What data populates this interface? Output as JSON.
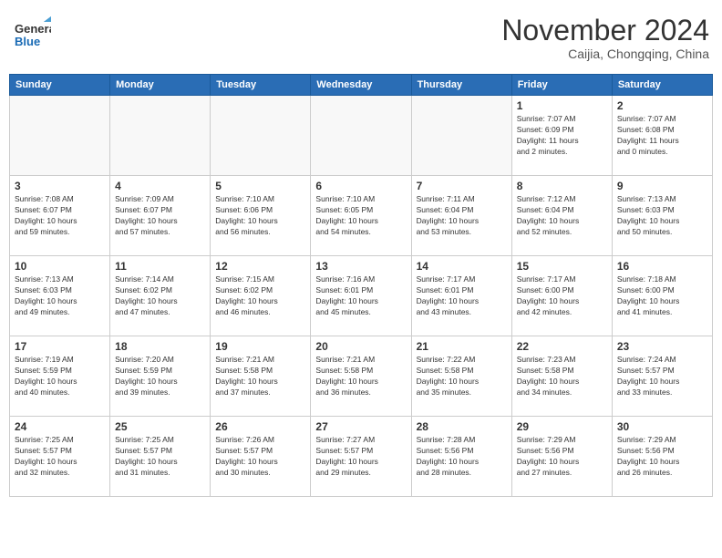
{
  "header": {
    "logo_general": "General",
    "logo_blue": "Blue",
    "month_title": "November 2024",
    "subtitle": "Caijia, Chongqing, China"
  },
  "weekdays": [
    "Sunday",
    "Monday",
    "Tuesday",
    "Wednesday",
    "Thursday",
    "Friday",
    "Saturday"
  ],
  "weeks": [
    [
      {
        "day": "",
        "info": ""
      },
      {
        "day": "",
        "info": ""
      },
      {
        "day": "",
        "info": ""
      },
      {
        "day": "",
        "info": ""
      },
      {
        "day": "",
        "info": ""
      },
      {
        "day": "1",
        "info": "Sunrise: 7:07 AM\nSunset: 6:09 PM\nDaylight: 11 hours\nand 2 minutes."
      },
      {
        "day": "2",
        "info": "Sunrise: 7:07 AM\nSunset: 6:08 PM\nDaylight: 11 hours\nand 0 minutes."
      }
    ],
    [
      {
        "day": "3",
        "info": "Sunrise: 7:08 AM\nSunset: 6:07 PM\nDaylight: 10 hours\nand 59 minutes."
      },
      {
        "day": "4",
        "info": "Sunrise: 7:09 AM\nSunset: 6:07 PM\nDaylight: 10 hours\nand 57 minutes."
      },
      {
        "day": "5",
        "info": "Sunrise: 7:10 AM\nSunset: 6:06 PM\nDaylight: 10 hours\nand 56 minutes."
      },
      {
        "day": "6",
        "info": "Sunrise: 7:10 AM\nSunset: 6:05 PM\nDaylight: 10 hours\nand 54 minutes."
      },
      {
        "day": "7",
        "info": "Sunrise: 7:11 AM\nSunset: 6:04 PM\nDaylight: 10 hours\nand 53 minutes."
      },
      {
        "day": "8",
        "info": "Sunrise: 7:12 AM\nSunset: 6:04 PM\nDaylight: 10 hours\nand 52 minutes."
      },
      {
        "day": "9",
        "info": "Sunrise: 7:13 AM\nSunset: 6:03 PM\nDaylight: 10 hours\nand 50 minutes."
      }
    ],
    [
      {
        "day": "10",
        "info": "Sunrise: 7:13 AM\nSunset: 6:03 PM\nDaylight: 10 hours\nand 49 minutes."
      },
      {
        "day": "11",
        "info": "Sunrise: 7:14 AM\nSunset: 6:02 PM\nDaylight: 10 hours\nand 47 minutes."
      },
      {
        "day": "12",
        "info": "Sunrise: 7:15 AM\nSunset: 6:02 PM\nDaylight: 10 hours\nand 46 minutes."
      },
      {
        "day": "13",
        "info": "Sunrise: 7:16 AM\nSunset: 6:01 PM\nDaylight: 10 hours\nand 45 minutes."
      },
      {
        "day": "14",
        "info": "Sunrise: 7:17 AM\nSunset: 6:01 PM\nDaylight: 10 hours\nand 43 minutes."
      },
      {
        "day": "15",
        "info": "Sunrise: 7:17 AM\nSunset: 6:00 PM\nDaylight: 10 hours\nand 42 minutes."
      },
      {
        "day": "16",
        "info": "Sunrise: 7:18 AM\nSunset: 6:00 PM\nDaylight: 10 hours\nand 41 minutes."
      }
    ],
    [
      {
        "day": "17",
        "info": "Sunrise: 7:19 AM\nSunset: 5:59 PM\nDaylight: 10 hours\nand 40 minutes."
      },
      {
        "day": "18",
        "info": "Sunrise: 7:20 AM\nSunset: 5:59 PM\nDaylight: 10 hours\nand 39 minutes."
      },
      {
        "day": "19",
        "info": "Sunrise: 7:21 AM\nSunset: 5:58 PM\nDaylight: 10 hours\nand 37 minutes."
      },
      {
        "day": "20",
        "info": "Sunrise: 7:21 AM\nSunset: 5:58 PM\nDaylight: 10 hours\nand 36 minutes."
      },
      {
        "day": "21",
        "info": "Sunrise: 7:22 AM\nSunset: 5:58 PM\nDaylight: 10 hours\nand 35 minutes."
      },
      {
        "day": "22",
        "info": "Sunrise: 7:23 AM\nSunset: 5:58 PM\nDaylight: 10 hours\nand 34 minutes."
      },
      {
        "day": "23",
        "info": "Sunrise: 7:24 AM\nSunset: 5:57 PM\nDaylight: 10 hours\nand 33 minutes."
      }
    ],
    [
      {
        "day": "24",
        "info": "Sunrise: 7:25 AM\nSunset: 5:57 PM\nDaylight: 10 hours\nand 32 minutes."
      },
      {
        "day": "25",
        "info": "Sunrise: 7:25 AM\nSunset: 5:57 PM\nDaylight: 10 hours\nand 31 minutes."
      },
      {
        "day": "26",
        "info": "Sunrise: 7:26 AM\nSunset: 5:57 PM\nDaylight: 10 hours\nand 30 minutes."
      },
      {
        "day": "27",
        "info": "Sunrise: 7:27 AM\nSunset: 5:57 PM\nDaylight: 10 hours\nand 29 minutes."
      },
      {
        "day": "28",
        "info": "Sunrise: 7:28 AM\nSunset: 5:56 PM\nDaylight: 10 hours\nand 28 minutes."
      },
      {
        "day": "29",
        "info": "Sunrise: 7:29 AM\nSunset: 5:56 PM\nDaylight: 10 hours\nand 27 minutes."
      },
      {
        "day": "30",
        "info": "Sunrise: 7:29 AM\nSunset: 5:56 PM\nDaylight: 10 hours\nand 26 minutes."
      }
    ]
  ]
}
